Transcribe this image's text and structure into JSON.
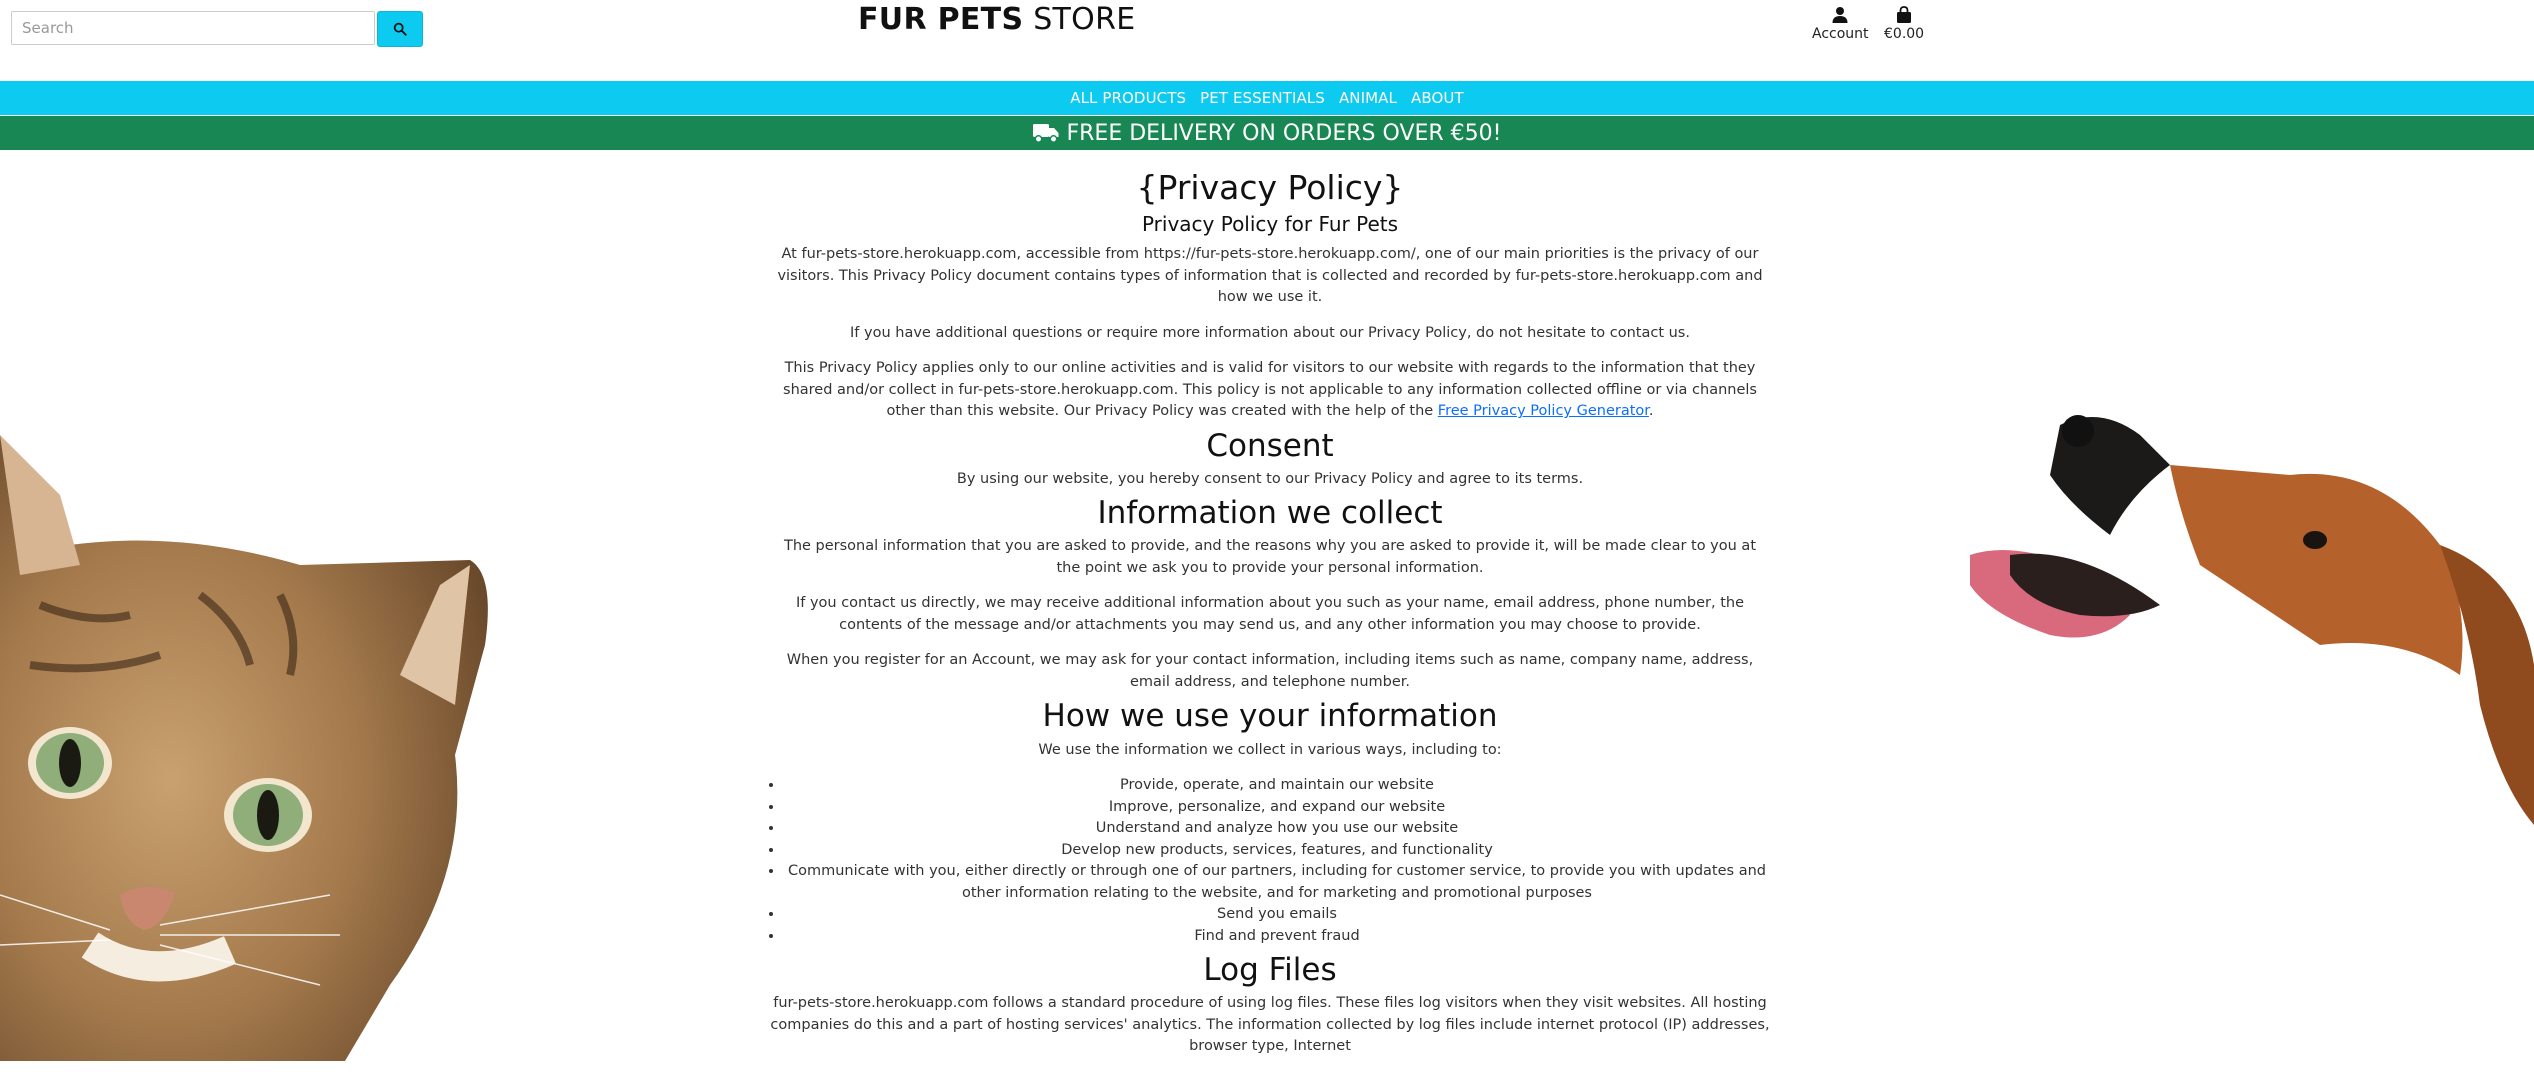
{
  "header": {
    "search_placeholder": "Search",
    "logo_bold": "FUR PETS",
    "logo_rest": " STORE",
    "account_label": "Account",
    "bag_total": "€0.00"
  },
  "nav": {
    "items": [
      "ALL PRODUCTS",
      "PET ESSENTIALS",
      "ANIMAL",
      "ABOUT"
    ]
  },
  "banner": {
    "text": "FREE DELIVERY ON ORDERS OVER €50!"
  },
  "policy": {
    "title": "{Privacy Policy}",
    "subtitle": "Privacy Policy for Fur Pets",
    "intro_p1": "At fur-pets-store.herokuapp.com, accessible from https://fur-pets-store.herokuapp.com/, one of our main priorities is the privacy of our visitors. This Privacy Policy document contains types of information that is collected and recorded by fur-pets-store.herokuapp.com and how we use it.",
    "intro_p2": "If you have additional questions or require more information about our Privacy Policy, do not hesitate to contact us.",
    "intro_p3_before": "This Privacy Policy applies only to our online activities and is valid for visitors to our website with regards to the information that they shared and/or collect in fur-pets-store.herokuapp.com. This policy is not applicable to any information collected offline or via channels other than this website. Our Privacy Policy was created with the help of the ",
    "intro_p3_link": "Free Privacy Policy Generator",
    "intro_p3_after": ".",
    "consent_heading": "Consent",
    "consent_p": "By using our website, you hereby consent to our Privacy Policy and agree to its terms.",
    "collect_heading": "Information we collect",
    "collect_p1": "The personal information that you are asked to provide, and the reasons why you are asked to provide it, will be made clear to you at the point we ask you to provide your personal information.",
    "collect_p2": "If you contact us directly, we may receive additional information about you such as your name, email address, phone number, the contents of the message and/or attachments you may send us, and any other information you may choose to provide.",
    "collect_p3": "When you register for an Account, we may ask for your contact information, including items such as name, company name, address, email address, and telephone number.",
    "use_heading": "How we use your information",
    "use_intro": "We use the information we collect in various ways, including to:",
    "use_items": [
      "Provide, operate, and maintain our website",
      "Improve, personalize, and expand our website",
      "Understand and analyze how you use our website",
      "Develop new products, services, features, and functionality",
      "Communicate with you, either directly or through one of our partners, including for customer service, to provide you with updates and other information relating to the website, and for marketing and promotional purposes",
      "Send you emails",
      "Find and prevent fraud"
    ],
    "logs_heading": "Log Files",
    "logs_p": "fur-pets-store.herokuapp.com follows a standard procedure of using log files. These files log visitors when they visit websites. All hosting companies do this and a part of hosting services' analytics. The information collected by log files include internet protocol (IP) addresses, browser type, Internet"
  },
  "colors": {
    "nav_bg": "#0dcaf0",
    "banner_bg": "#198754",
    "link": "#0d6efd"
  }
}
